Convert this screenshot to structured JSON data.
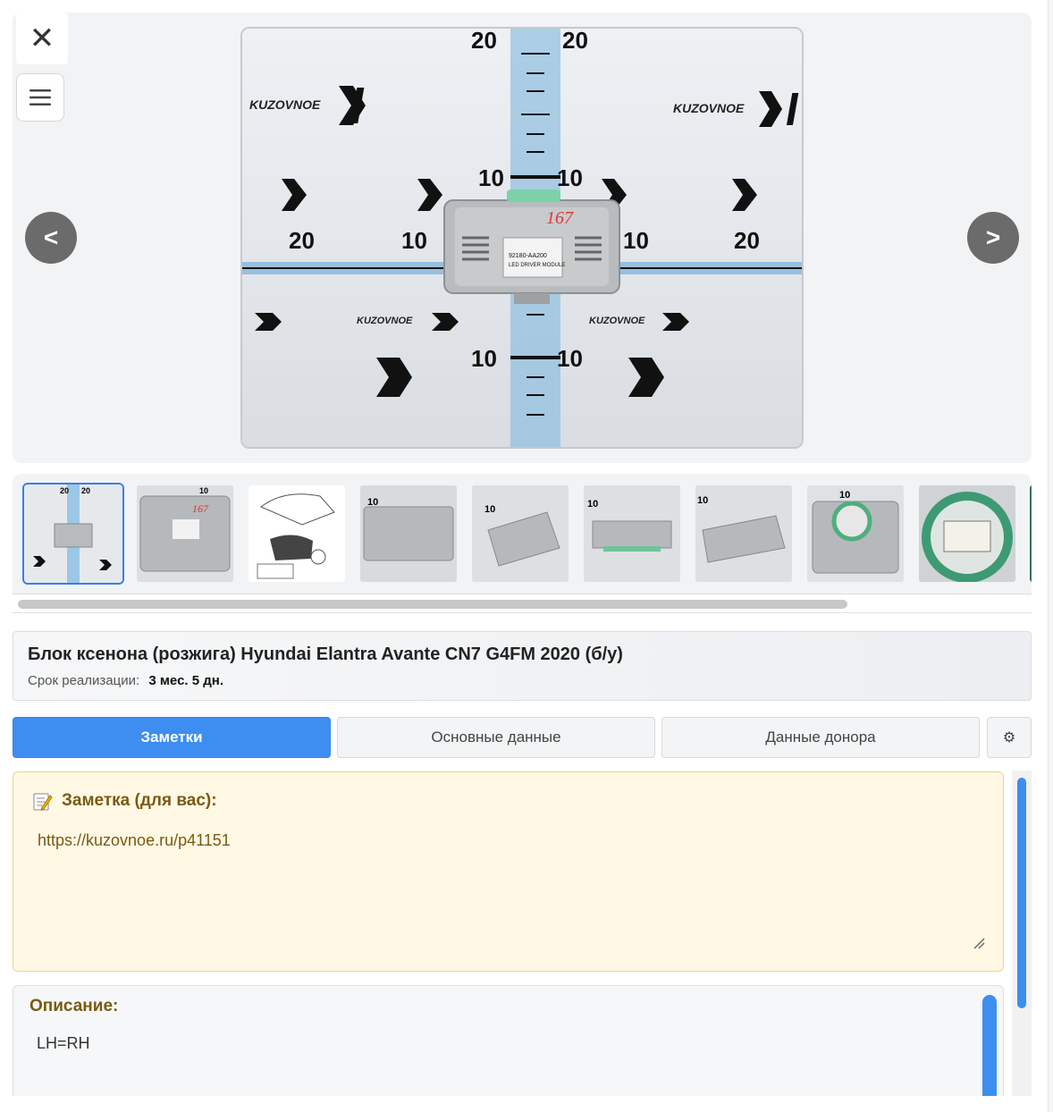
{
  "gallery": {
    "close_label": "✕",
    "prev_label": "<",
    "next_label": ">",
    "main_photo": {
      "watermark": "KUZOVNOE",
      "ruler_top": [
        "20",
        "20"
      ],
      "ruler_mid": [
        "10",
        "10"
      ],
      "ruler_side": [
        "20",
        "10",
        "10",
        "20"
      ],
      "ruler_bottom": [
        "10",
        "10"
      ],
      "part_marking": "167",
      "label_line1": "92180-AA200",
      "label_line2": "LED DRIVER MODULE"
    }
  },
  "thumbnails": {
    "count": 10,
    "active_index": 0,
    "labels": [
      "20",
      "20",
      "10",
      "10",
      "10",
      "167",
      "10",
      "10",
      "10"
    ]
  },
  "product": {
    "title": "Блок ксенона (розжига) Hyundai Elantra Avante CN7 G4FM 2020 (б/у)",
    "term_label": "Срок реализации:",
    "term_value": "3 мес. 5 дн."
  },
  "tabs": {
    "notes": "Заметки",
    "main": "Основные данные",
    "donor": "Данные донора",
    "settings": "⚙"
  },
  "note": {
    "title": "Заметка (для вас):",
    "text": "https://kuzovnoe.ru/p41151"
  },
  "description": {
    "title": "Описание:",
    "text": "LH=RH"
  },
  "colors": {
    "accent": "#3d8ef0",
    "note_bg": "#fff8e5",
    "note_text": "#7a5a12"
  }
}
